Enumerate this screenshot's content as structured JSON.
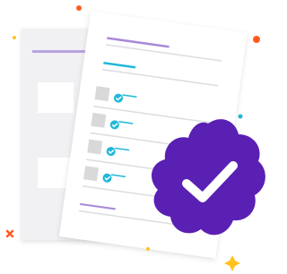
{
  "illustration": {
    "icon": "verified-checklist-illustration",
    "badge_icon": "verified-badge-check-icon"
  },
  "colors": {
    "badge": "#5a1fb3",
    "check": "#ffffff",
    "checkbox_mark": "#1fb8d8",
    "checkbox_box": "#d9d9d9",
    "paper": "#ffffff",
    "paper_back": "#f0f0f3",
    "paper_lines": "#dcdce2",
    "accent_line": "#a98bd9",
    "confetti_orange": "#ff5a1f",
    "confetti_yellow": "#ffc21f",
    "confetti_teal": "#1fb8d8"
  }
}
